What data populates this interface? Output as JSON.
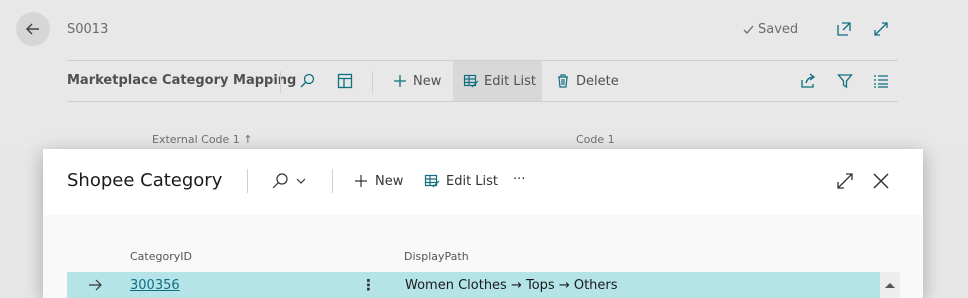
{
  "background": {
    "record_id": "S0013",
    "saved_status": "Saved",
    "page_title": "Marketplace Category Mapping",
    "toolbar": {
      "new_label": "New",
      "edit_list_label": "Edit List",
      "delete_label": "Delete"
    },
    "columns": [
      "External Code 1 ↑",
      "Code 1"
    ]
  },
  "dialog": {
    "title": "Shopee Category",
    "toolbar": {
      "new_label": "New",
      "edit_list_label": "Edit List",
      "more_label": "···"
    },
    "columns": [
      "CategoryID",
      "DisplayPath"
    ],
    "rows": [
      {
        "id": "300356",
        "path": "Women Clothes → Tops → Others"
      }
    ]
  },
  "colors": {
    "accent": "#0f6f80",
    "selected_row": "#b4e4e8"
  },
  "icons": [
    "back-arrow-icon",
    "check-icon",
    "open-new-window-icon",
    "expand-icon",
    "search-icon",
    "layout-icon",
    "plus-icon",
    "edit-list-icon",
    "trash-icon",
    "share-icon",
    "filter-icon",
    "list-icon",
    "chevron-down-icon",
    "close-icon",
    "row-arrow-icon",
    "scroll-up-icon"
  ]
}
